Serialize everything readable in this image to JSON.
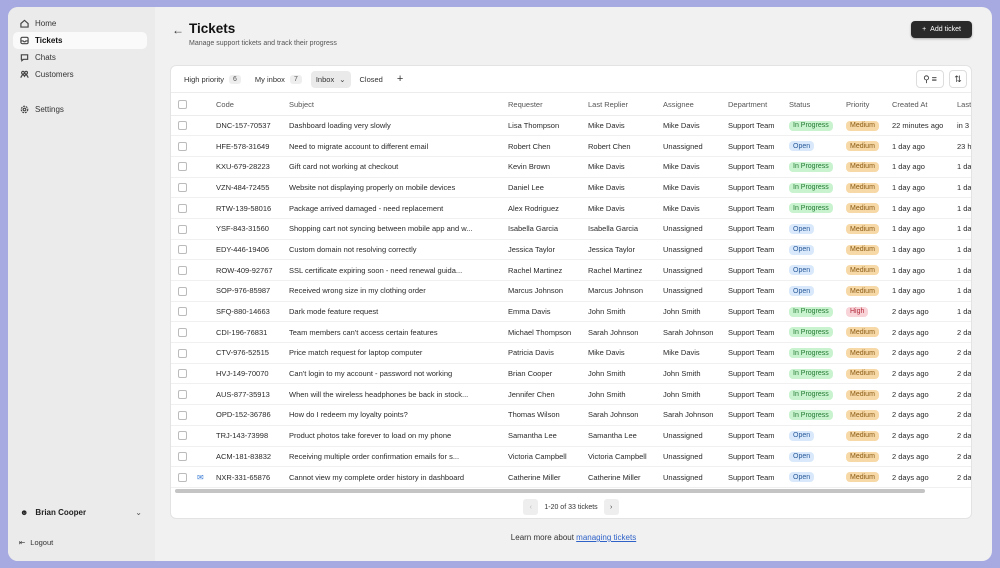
{
  "sidebar": {
    "items": [
      {
        "label": "Home",
        "icon": "home-icon"
      },
      {
        "label": "Tickets",
        "icon": "inbox-icon"
      },
      {
        "label": "Chats",
        "icon": "chat-icon"
      },
      {
        "label": "Customers",
        "icon": "users-icon"
      },
      {
        "label": "Settings",
        "icon": "gear-icon"
      }
    ],
    "user": "Brian Cooper",
    "logout": "Logout"
  },
  "header": {
    "title": "Tickets",
    "subtitle": "Manage support tickets and track their progress",
    "add_label": "Add ticket"
  },
  "tabs": [
    {
      "label": "High priority",
      "count": "6"
    },
    {
      "label": "My inbox",
      "count": "7"
    },
    {
      "label": "Inbox"
    },
    {
      "label": "Closed"
    }
  ],
  "columns": [
    "Code",
    "Subject",
    "Requester",
    "Last Replier",
    "Assignee",
    "Department",
    "Status",
    "Priority",
    "Created At",
    "Last"
  ],
  "rows": [
    [
      "DNC-157-70537",
      "Dashboard loading very slowly",
      "Lisa Thompson",
      "Mike Davis",
      "Mike Davis",
      "Support Team",
      "In Progress",
      "Medium",
      "22 minutes ago",
      "in 3"
    ],
    [
      "HFE-578-31649",
      "Need to migrate account to different email",
      "Robert Chen",
      "Robert Chen",
      "Unassigned",
      "Support Team",
      "Open",
      "Medium",
      "1 day ago",
      "23 h"
    ],
    [
      "KXU-679-28223",
      "Gift card not working at checkout",
      "Kevin Brown",
      "Mike Davis",
      "Mike Davis",
      "Support Team",
      "In Progress",
      "Medium",
      "1 day ago",
      "1 da"
    ],
    [
      "VZN-484-72455",
      "Website not displaying properly on mobile devices",
      "Daniel Lee",
      "Mike Davis",
      "Mike Davis",
      "Support Team",
      "In Progress",
      "Medium",
      "1 day ago",
      "1 da"
    ],
    [
      "RTW-139-58016",
      "Package arrived damaged - need replacement",
      "Alex Rodriguez",
      "Mike Davis",
      "Mike Davis",
      "Support Team",
      "In Progress",
      "Medium",
      "1 day ago",
      "1 da"
    ],
    [
      "YSF-843-31560",
      "Shopping cart not syncing between mobile app and w...",
      "Isabella Garcia",
      "Isabella Garcia",
      "Unassigned",
      "Support Team",
      "Open",
      "Medium",
      "1 day ago",
      "1 da"
    ],
    [
      "EDY-446-19406",
      "Custom domain not resolving correctly",
      "Jessica Taylor",
      "Jessica Taylor",
      "Unassigned",
      "Support Team",
      "Open",
      "Medium",
      "1 day ago",
      "1 da"
    ],
    [
      "ROW-409-92767",
      "SSL certificate expiring soon - need renewal guida...",
      "Rachel Martinez",
      "Rachel Martinez",
      "Unassigned",
      "Support Team",
      "Open",
      "Medium",
      "1 day ago",
      "1 da"
    ],
    [
      "SOP-976-85987",
      "Received wrong size in my clothing order",
      "Marcus Johnson",
      "Marcus Johnson",
      "Unassigned",
      "Support Team",
      "Open",
      "Medium",
      "1 day ago",
      "1 da"
    ],
    [
      "SFQ-880-14663",
      "Dark mode feature request",
      "Emma Davis",
      "John Smith",
      "John Smith",
      "Support Team",
      "In Progress",
      "High",
      "2 days ago",
      "1 da"
    ],
    [
      "CDI-196-76831",
      "Team members can't access certain features",
      "Michael Thompson",
      "Sarah Johnson",
      "Sarah Johnson",
      "Support Team",
      "In Progress",
      "Medium",
      "2 days ago",
      "2 da"
    ],
    [
      "CTV-976-52515",
      "Price match request for laptop computer",
      "Patricia Davis",
      "Mike Davis",
      "Mike Davis",
      "Support Team",
      "In Progress",
      "Medium",
      "2 days ago",
      "2 da"
    ],
    [
      "HVJ-149-70070",
      "Can't login to my account - password not working",
      "Brian Cooper",
      "John Smith",
      "John Smith",
      "Support Team",
      "In Progress",
      "Medium",
      "2 days ago",
      "2 da"
    ],
    [
      "AUS-877-35913",
      "When will the wireless headphones be back in stock...",
      "Jennifer Chen",
      "John Smith",
      "John Smith",
      "Support Team",
      "In Progress",
      "Medium",
      "2 days ago",
      "2 da"
    ],
    [
      "OPD-152-36786",
      "How do I redeem my loyalty points?",
      "Thomas Wilson",
      "Sarah Johnson",
      "Sarah Johnson",
      "Support Team",
      "In Progress",
      "Medium",
      "2 days ago",
      "2 da"
    ],
    [
      "TRJ-143-73998",
      "Product photos take forever to load on my phone",
      "Samantha Lee",
      "Samantha Lee",
      "Unassigned",
      "Support Team",
      "Open",
      "Medium",
      "2 days ago",
      "2 da"
    ],
    [
      "ACM-181-83832",
      "Receiving multiple order confirmation emails for s...",
      "Victoria Campbell",
      "Victoria Campbell",
      "Unassigned",
      "Support Team",
      "Open",
      "Medium",
      "2 days ago",
      "2 da"
    ],
    [
      "NXR-331-65876",
      "Cannot view my complete order history in dashboard",
      "Catherine Miller",
      "Catherine Miller",
      "Unassigned",
      "Support Team",
      "Open",
      "Medium",
      "2 days ago",
      "2 da"
    ]
  ],
  "pagination": {
    "label": "1-20 of 33 tickets"
  },
  "footer": {
    "text": "Learn more about ",
    "link": "managing tickets"
  }
}
